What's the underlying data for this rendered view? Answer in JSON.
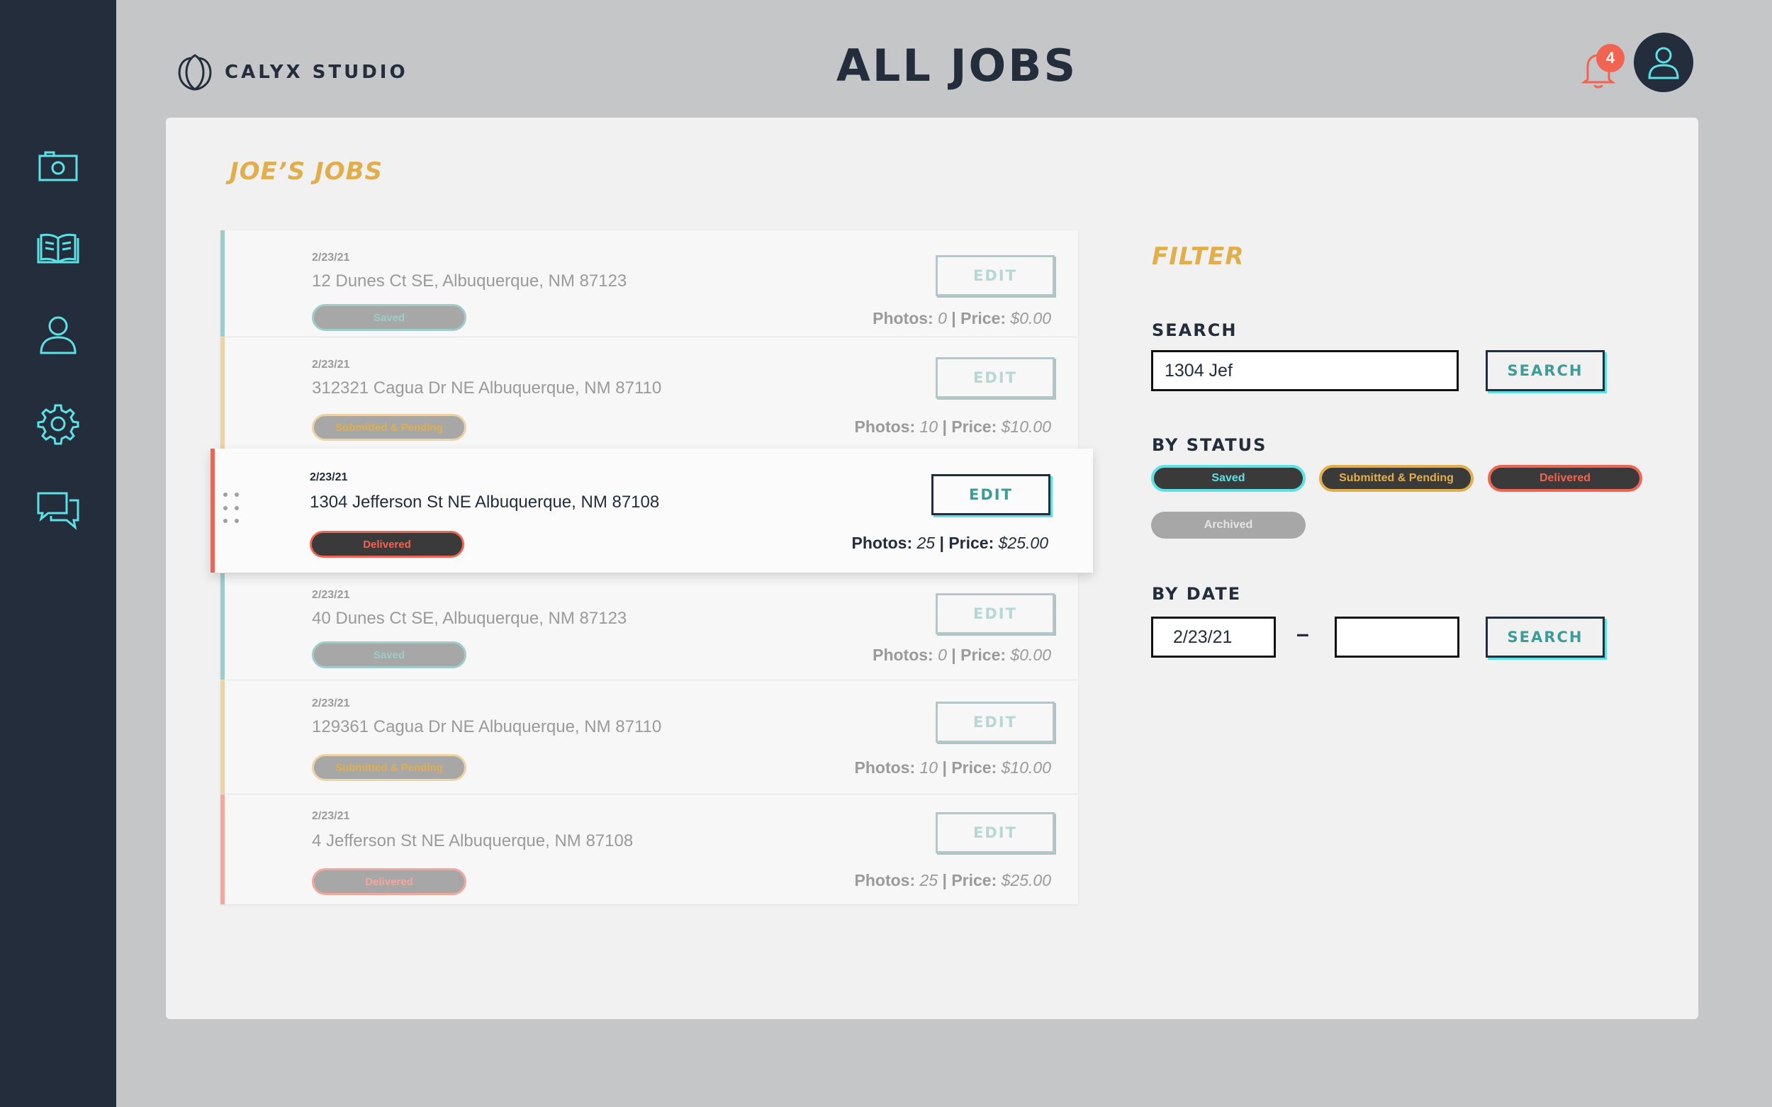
{
  "app": {
    "brand": "CALYX STUDIO",
    "page_title": "ALL JOBS",
    "notification_count": "4"
  },
  "sidebar": {
    "items": [
      {
        "icon": "camera-icon"
      },
      {
        "icon": "book-icon"
      },
      {
        "icon": "user-icon"
      },
      {
        "icon": "gear-icon"
      },
      {
        "icon": "chat-icon"
      }
    ]
  },
  "jobs": {
    "title": "JOE’S JOBS",
    "rows": [
      {
        "date": "2/23/21",
        "address": "12 Dunes Ct SE, Albuquerque, NM 87123",
        "status": "Saved",
        "photos_label": "Photos:",
        "photos": "0",
        "price_label": "| Price:",
        "price": "$0.00",
        "edit": "EDIT"
      },
      {
        "date": "2/23/21",
        "address": "312321 Cagua Dr NE Albuquerque, NM 87110",
        "status": "Submitted & Pending",
        "photos_label": "Photos:",
        "photos": "10",
        "price_label": "| Price:",
        "price": "$10.00",
        "edit": "EDIT"
      },
      {
        "date": "2/23/21",
        "address": "1304 Jefferson St NE Albuquerque, NM 87108",
        "status": "Delivered",
        "photos_label": "Photos:",
        "photos": "25",
        "price_label": "| Price:",
        "price": "$25.00",
        "edit": "EDIT"
      },
      {
        "date": "2/23/21",
        "address": "40 Dunes Ct SE, Albuquerque, NM 87123",
        "status": "Saved",
        "photos_label": "Photos:",
        "photos": "0",
        "price_label": "| Price:",
        "price": "$0.00",
        "edit": "EDIT"
      },
      {
        "date": "2/23/21",
        "address": "129361 Cagua Dr NE Albuquerque, NM 87110",
        "status": "Submitted & Pending",
        "photos_label": "Photos:",
        "photos": "10",
        "price_label": "| Price:",
        "price": "$10.00",
        "edit": "EDIT"
      },
      {
        "date": "2/23/21",
        "address": "4 Jefferson St NE Albuquerque, NM 87108",
        "status": "Delivered",
        "photos_label": "Photos:",
        "photos": "25",
        "price_label": "| Price:",
        "price": "$25.00",
        "edit": "EDIT"
      }
    ]
  },
  "filter": {
    "title": "FILTER",
    "search_label": "SEARCH",
    "search_value": "1304 Jef",
    "search_button": "SEARCH",
    "status_label": "BY STATUS",
    "statuses": [
      "Saved",
      "Submitted & Pending",
      "Delivered",
      "Archived"
    ],
    "date_label": "BY DATE",
    "date_from": "2/23/21",
    "date_to": "",
    "date_separator": "–",
    "date_button": "SEARCH"
  },
  "colors": {
    "sidebar": "#232d3b",
    "accent_cyan": "#5ce1e6",
    "accent_teal": "#3d9c98",
    "accent_gold": "#e1ae4c",
    "accent_red": "#f26452"
  }
}
